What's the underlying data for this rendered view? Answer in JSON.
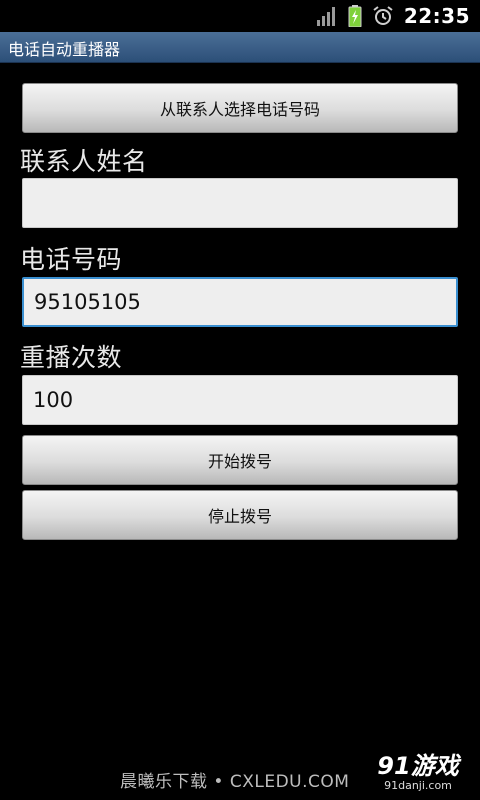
{
  "status_bar": {
    "time": "22:35",
    "icons": [
      "signal-icon",
      "battery-charging-icon",
      "alarm-icon"
    ]
  },
  "app": {
    "title": "电话自动重播器"
  },
  "form": {
    "pick_contact_button": "从联系人选择电话号码",
    "contact_name_label": "联系人姓名",
    "contact_name_value": "",
    "phone_label": "电话号码",
    "phone_value": "95105105",
    "redial_count_label": "重播次数",
    "redial_count_value": "100",
    "start_button": "开始拨号",
    "stop_button": "停止拨号"
  },
  "watermark": {
    "text": "晨曦乐下载 • CXLEDU.COM",
    "brand": "91游戏",
    "brand_site": "91danji.com"
  },
  "colors": {
    "background": "#000000",
    "title_bar": "#3a5f8a",
    "focus_border": "#3a8fd0",
    "battery_green": "#7fd13b"
  }
}
